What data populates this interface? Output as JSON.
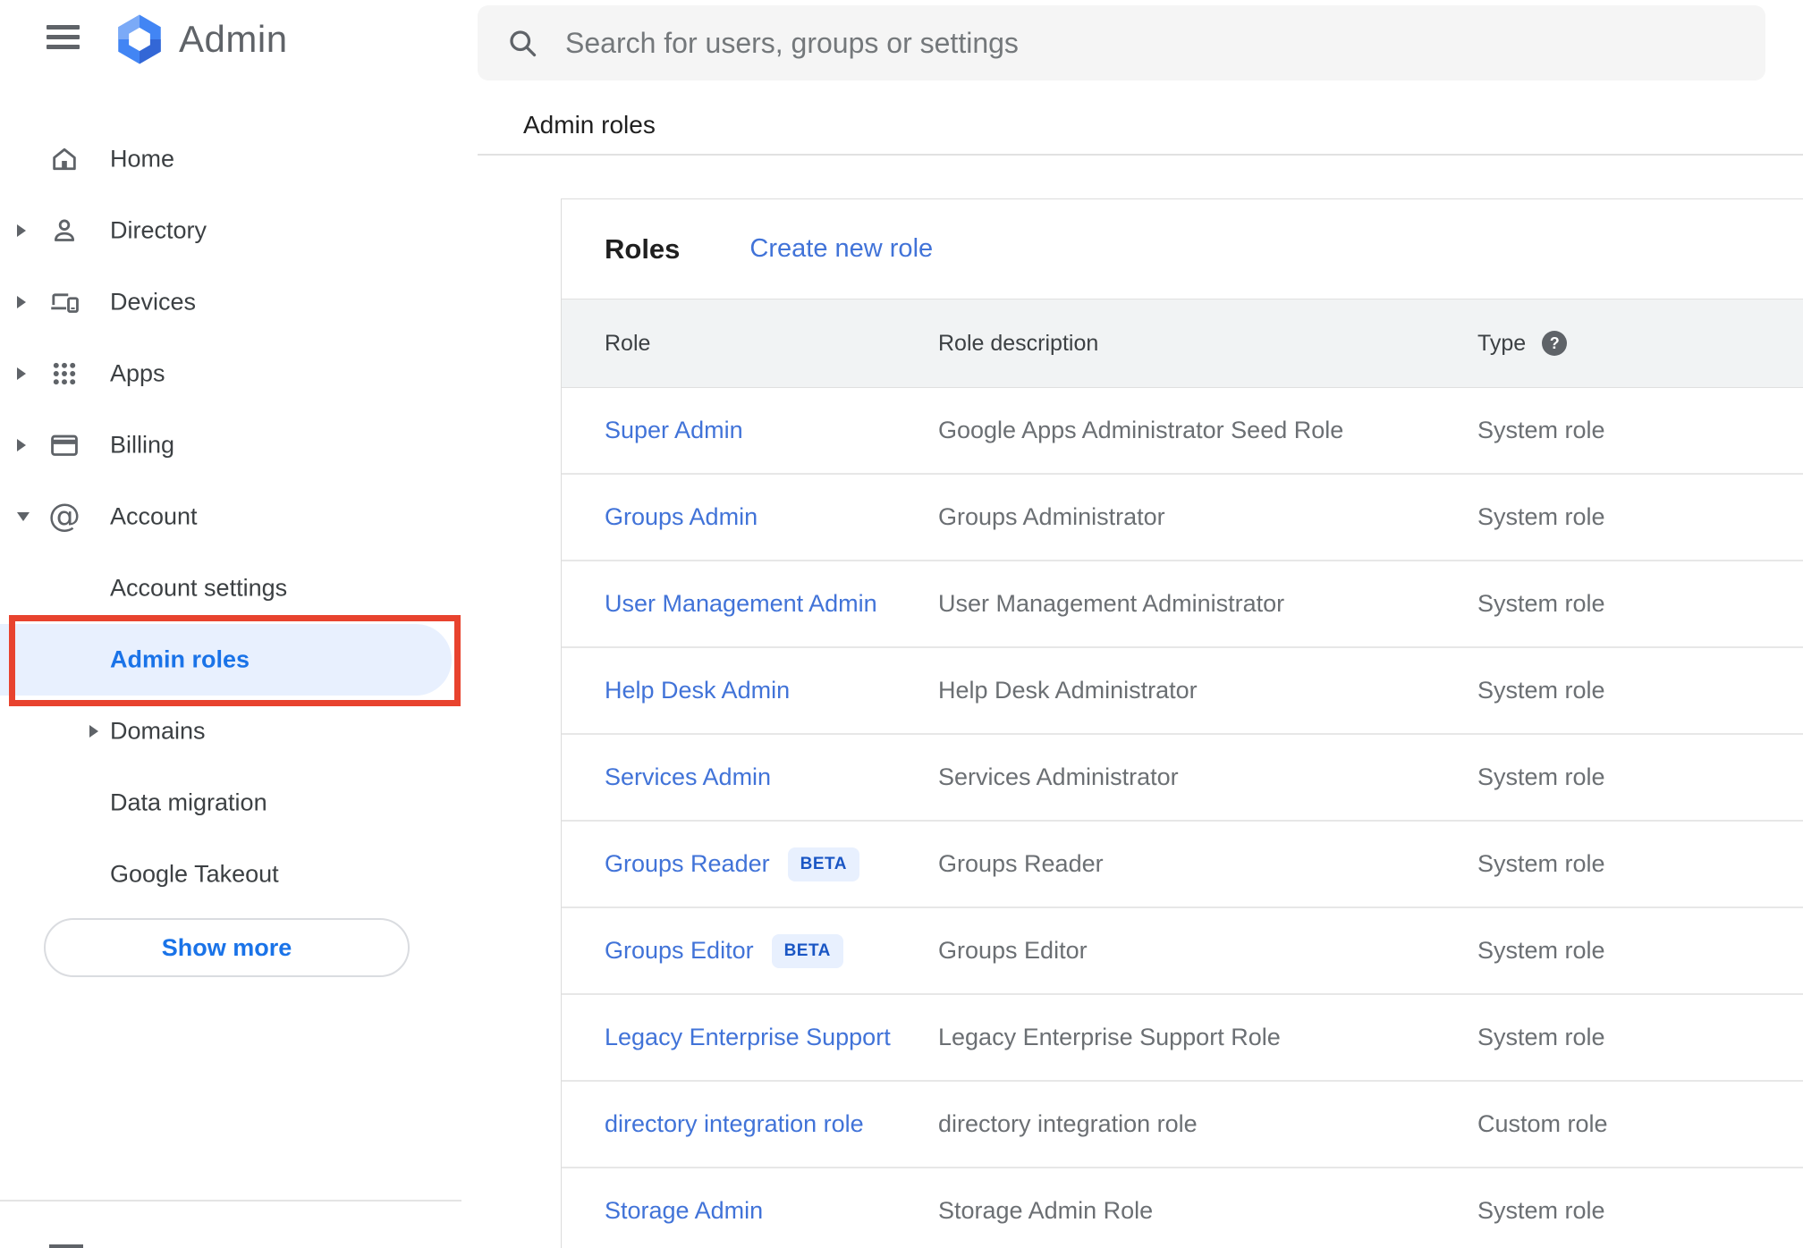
{
  "app": {
    "title": "Admin"
  },
  "search": {
    "placeholder": "Search for users, groups or settings"
  },
  "breadcrumb": "Admin roles",
  "sidebar": {
    "items": [
      {
        "label": "Home",
        "icon": "home",
        "expand": "none"
      },
      {
        "label": "Directory",
        "icon": "person",
        "expand": "collapsed"
      },
      {
        "label": "Devices",
        "icon": "devices",
        "expand": "collapsed"
      },
      {
        "label": "Apps",
        "icon": "apps",
        "expand": "collapsed"
      },
      {
        "label": "Billing",
        "icon": "card",
        "expand": "collapsed"
      },
      {
        "label": "Account",
        "icon": "at",
        "expand": "expanded"
      }
    ],
    "sub_items": [
      {
        "label": "Account settings",
        "active": false,
        "expand": "none"
      },
      {
        "label": "Admin roles",
        "active": true,
        "expand": "none"
      },
      {
        "label": "Domains",
        "active": false,
        "expand": "collapsed"
      },
      {
        "label": "Data migration",
        "active": false,
        "expand": "none"
      },
      {
        "label": "Google Takeout",
        "active": false,
        "expand": "none"
      }
    ],
    "show_more_label": "Show more"
  },
  "roles_panel": {
    "title": "Roles",
    "create_link": "Create new role",
    "columns": [
      "Role",
      "Role description",
      "Type"
    ],
    "beta_label": "BETA",
    "rows": [
      {
        "role": "Super Admin",
        "beta": false,
        "description": "Google Apps Administrator Seed Role",
        "type": "System role"
      },
      {
        "role": "Groups Admin",
        "beta": false,
        "description": "Groups Administrator",
        "type": "System role"
      },
      {
        "role": "User Management Admin",
        "beta": false,
        "description": "User Management Administrator",
        "type": "System role"
      },
      {
        "role": "Help Desk Admin",
        "beta": false,
        "description": "Help Desk Administrator",
        "type": "System role"
      },
      {
        "role": "Services Admin",
        "beta": false,
        "description": "Services Administrator",
        "type": "System role"
      },
      {
        "role": "Groups Reader",
        "beta": true,
        "description": "Groups Reader",
        "type": "System role"
      },
      {
        "role": "Groups Editor",
        "beta": true,
        "description": "Groups Editor",
        "type": "System role"
      },
      {
        "role": "Legacy Enterprise Support",
        "beta": false,
        "description": "Legacy Enterprise Support Role",
        "type": "System role"
      },
      {
        "role": "directory integration role",
        "beta": false,
        "description": "directory integration role",
        "type": "Custom role"
      },
      {
        "role": "Storage Admin",
        "beta": false,
        "description": "Storage Admin Role",
        "type": "System role"
      }
    ]
  },
  "colors": {
    "link_blue": "#4173d8",
    "active_item_blue": "#1a73e8",
    "active_pill_bg": "#e8f0fe",
    "beta_badge_bg": "#e8f0fe",
    "beta_badge_text": "#1a56c4",
    "annotation_red": "#e8432e",
    "header_band_bg": "#f1f3f4",
    "search_bar_bg": "#f5f5f5",
    "logo_blue": "#4285f4"
  }
}
